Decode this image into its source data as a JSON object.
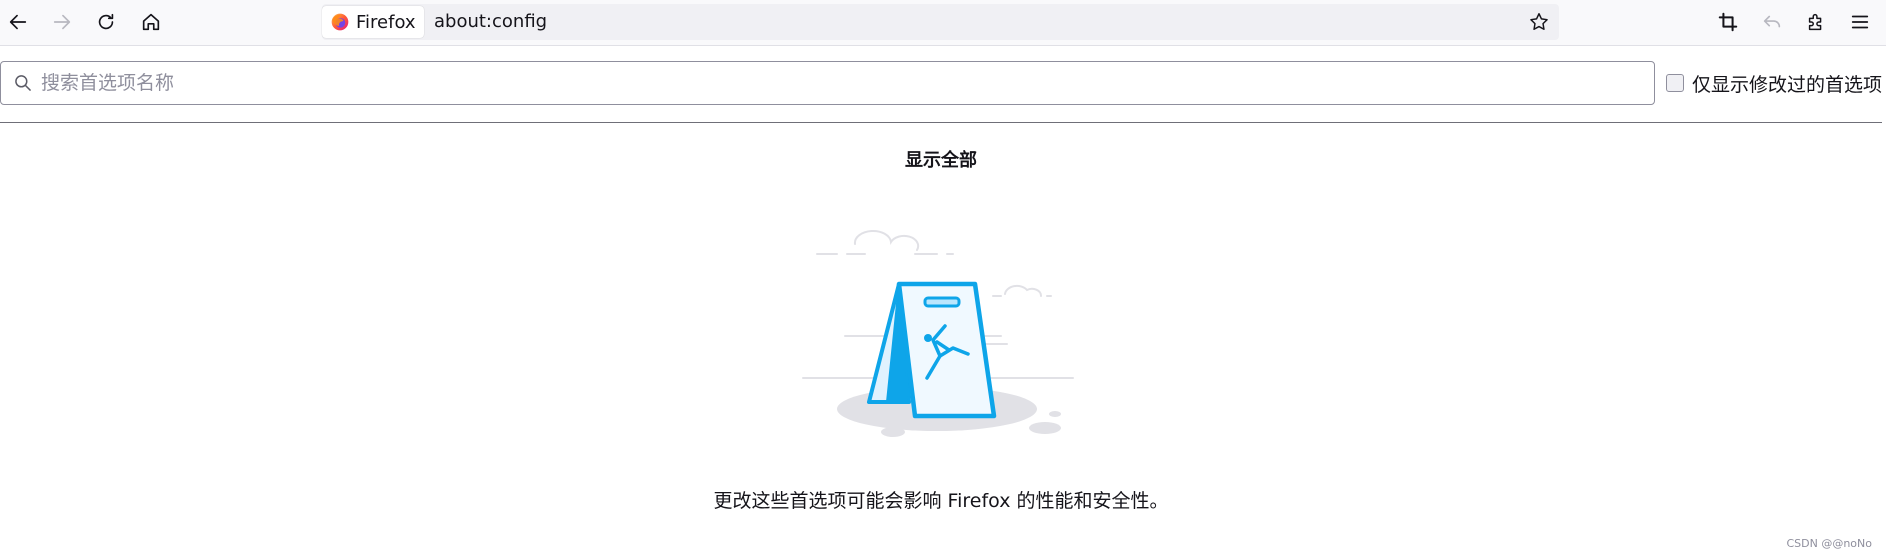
{
  "toolbar": {
    "back_icon": "arrow-left-icon",
    "forward_icon": "arrow-right-icon",
    "reload_icon": "reload-icon",
    "home_icon": "home-icon",
    "identity_label": "Firefox",
    "url": "about:config",
    "bookmark_icon": "star-icon",
    "screenshot_icon": "crop-icon",
    "undo_icon": "undo-icon",
    "extensions_icon": "puzzle-icon",
    "menu_icon": "hamburger-icon"
  },
  "search": {
    "placeholder": "搜索首选项名称",
    "value": "",
    "show_modified_label": "仅显示修改过的首选项",
    "show_modified_checked": false
  },
  "content": {
    "show_all_label": "显示全部",
    "warning_text": "更改这些首选项可能会影响 Firefox 的性能和安全性。"
  },
  "watermark": "CSDN @@noNo",
  "colors": {
    "toolbar_bg": "#f9f9fb",
    "urlbar_bg": "#f0f0f4",
    "illustration_blue": "#0ea5e9",
    "text": "#15141a"
  }
}
